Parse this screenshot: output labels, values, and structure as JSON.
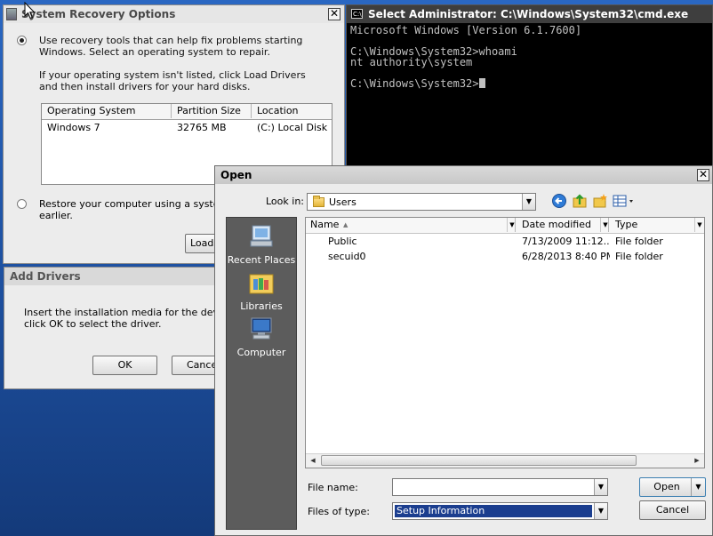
{
  "recovery": {
    "title": "System Recovery Options",
    "option1_text": "Use recovery tools that can help fix problems starting Windows. Select an operating system to repair.",
    "option1_note": "If your operating system isn't listed, click Load Drivers and then install drivers for your hard disks.",
    "table": {
      "headers": [
        "Operating System",
        "Partition Size",
        "Location"
      ],
      "rows": [
        [
          "Windows 7",
          "32765 MB",
          "(C:) Local Disk"
        ]
      ]
    },
    "option2_text": "Restore your computer using a system im",
    "option2_text_2": "earlier.",
    "load_drivers_label": "Load D"
  },
  "add_drivers": {
    "title": "Add Drivers",
    "message_line1": "Insert the installation media for the device ar",
    "message_line2": "click OK to select the driver.",
    "ok_label": "OK",
    "cancel_label": "Cance"
  },
  "cmd": {
    "title": "Select Administrator: C:\\Windows\\System32\\cmd.exe",
    "icon_text": "C:\\",
    "lines": [
      "Microsoft Windows [Version 6.1.7600]",
      "",
      "C:\\Windows\\System32>whoami",
      "nt authority\\system",
      "",
      "C:\\Windows\\System32>"
    ]
  },
  "open_dialog": {
    "title": "Open",
    "look_in_label": "Look in:",
    "look_in_value": "Users",
    "places": [
      "Recent Places",
      "Libraries",
      "Computer"
    ],
    "columns": [
      "Name",
      "Date modified",
      "Type"
    ],
    "files": [
      {
        "name": "Public",
        "date": "7/13/2009 11:12...",
        "type": "File folder"
      },
      {
        "name": "secuid0",
        "date": "6/28/2013 8:40 PM",
        "type": "File folder"
      }
    ],
    "file_name_label": "File name:",
    "file_name_value": "",
    "files_of_type_label": "Files of type:",
    "files_of_type_value": "Setup Information",
    "open_label": "Open",
    "cancel_label": "Cancel"
  }
}
